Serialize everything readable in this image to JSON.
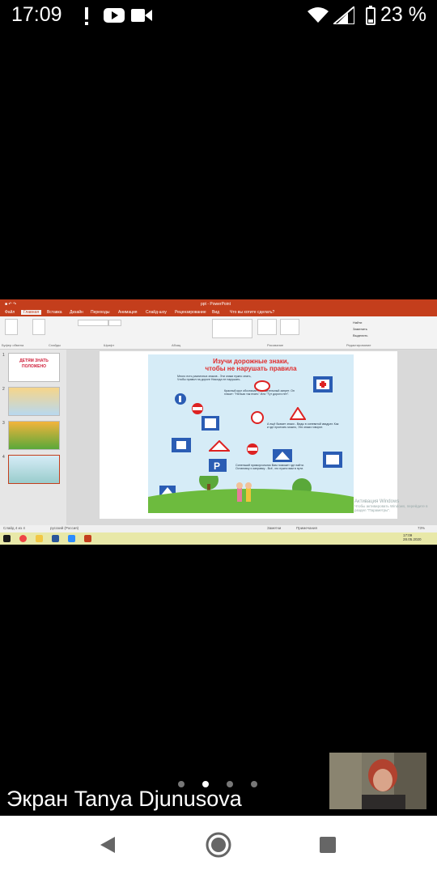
{
  "status_bar": {
    "time": "17:09",
    "battery_percent": "23 %",
    "icons": [
      "exclamation-icon",
      "youtube-icon",
      "video-camera-icon",
      "wifi-icon",
      "signal-icon",
      "battery-icon"
    ]
  },
  "shared_screen": {
    "ribbon": {
      "title": "ppt - PowerPoint",
      "tabs": [
        "Файл",
        "Главная",
        "Вставка",
        "Дизайн",
        "Переходы",
        "Анимация",
        "Слайд-шоу",
        "Рецензирование",
        "Вид"
      ],
      "search_placeholder": "Что вы хотите сделать?",
      "group_labels": [
        "Буфер обмена",
        "Слайды",
        "Шрифт",
        "Абзац",
        "Рисование",
        "Редактирование"
      ],
      "right_labels": [
        "Найти",
        "Заменить",
        "Выделить"
      ]
    },
    "thumbnails": [
      {
        "num": "1",
        "caption": "ДЕТЯМ ЗНАТЬ ПОЛОЖЕНО"
      },
      {
        "num": "2",
        "caption": ""
      },
      {
        "num": "3",
        "caption": ""
      },
      {
        "num": "4",
        "caption": ""
      }
    ],
    "slide": {
      "title_line1": "Изучи дорожные знаки,",
      "title_line2": "чтобы не нарушать правила",
      "texts": [
        "Много есть различных знаков - Эти знаки нужно знать, Чтобы правил на дороге Никогда не нарушать.",
        "Красный круг обозначает: Обязательный запрет. Он гласит: \"Нельзя так ехать\" Или \"Тут дороги нет\".",
        "А ещё бывает знаки - Виды в синеватой квадрат. Как и где проехать можно, Эти знаки говорят.",
        "Синенький прямоугольник Вам поможет где найти. Остановку и заправку - Всё, что нужно вам в пути."
      ]
    },
    "status": {
      "slide_counter": "Слайд 4 из 4",
      "language": "русский (Россия)",
      "notes": "Заметки",
      "comments": "Примечания",
      "zoom": "73%"
    },
    "watermark_line1": "Активация Windows",
    "watermark_line2": "Чтобы активировать Windows, перейдите в раздел \"Параметры\".",
    "taskbar_time": "17:09",
    "taskbar_date": "28.05.2020"
  },
  "overlay": {
    "screen_owner": "Экран Tanya Djunusova",
    "page_dots": 4,
    "active_dot": 1
  },
  "nav_bar": {
    "icons": [
      "back-triangle-icon",
      "home-circle-icon",
      "recents-square-icon"
    ]
  },
  "colors": {
    "ribbon_accent": "#c43e1c",
    "poster_title": "#e02b2b",
    "taskbar": "#e8e8a8"
  }
}
